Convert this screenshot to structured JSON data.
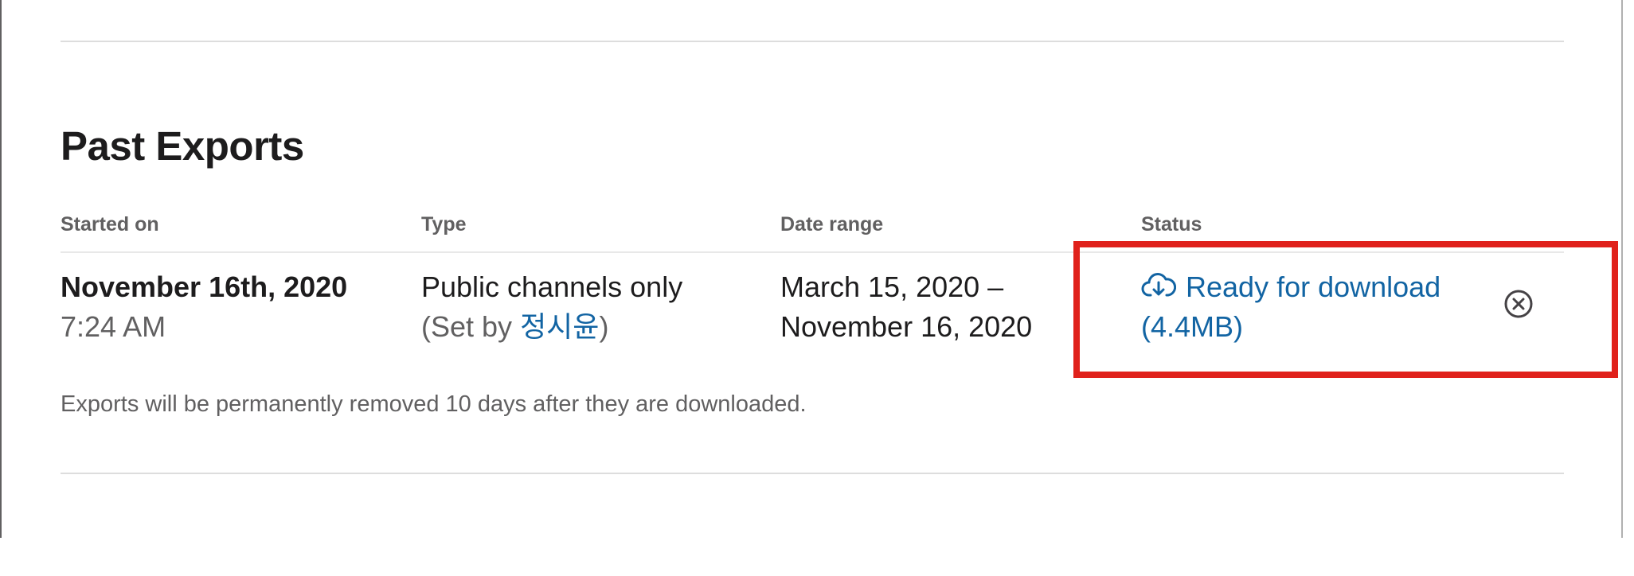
{
  "section": {
    "title": "Past Exports"
  },
  "table": {
    "headers": {
      "started_on": "Started on",
      "type": "Type",
      "date_range": "Date range",
      "status": "Status"
    },
    "rows": [
      {
        "started_date": "November 16th, 2020",
        "started_time": "7:24 AM",
        "type": "Public channels only",
        "set_by_prefix": "(Set by ",
        "set_by_user": "정시윤",
        "set_by_suffix": ")",
        "date_range_start": "March 15, 2020 –",
        "date_range_end": "November 16, 2020",
        "status_label": "Ready for download",
        "status_size": "(4.4MB)",
        "status_icon": "cloud-download-icon",
        "remove_icon": "close-circle-icon"
      }
    ]
  },
  "footnote": "Exports will be permanently removed 10 days after they are downloaded.",
  "colors": {
    "link": "#1264a3",
    "text": "#1d1c1d",
    "muted": "#616061",
    "highlight": "#e0211b",
    "divider": "#dddddd"
  }
}
